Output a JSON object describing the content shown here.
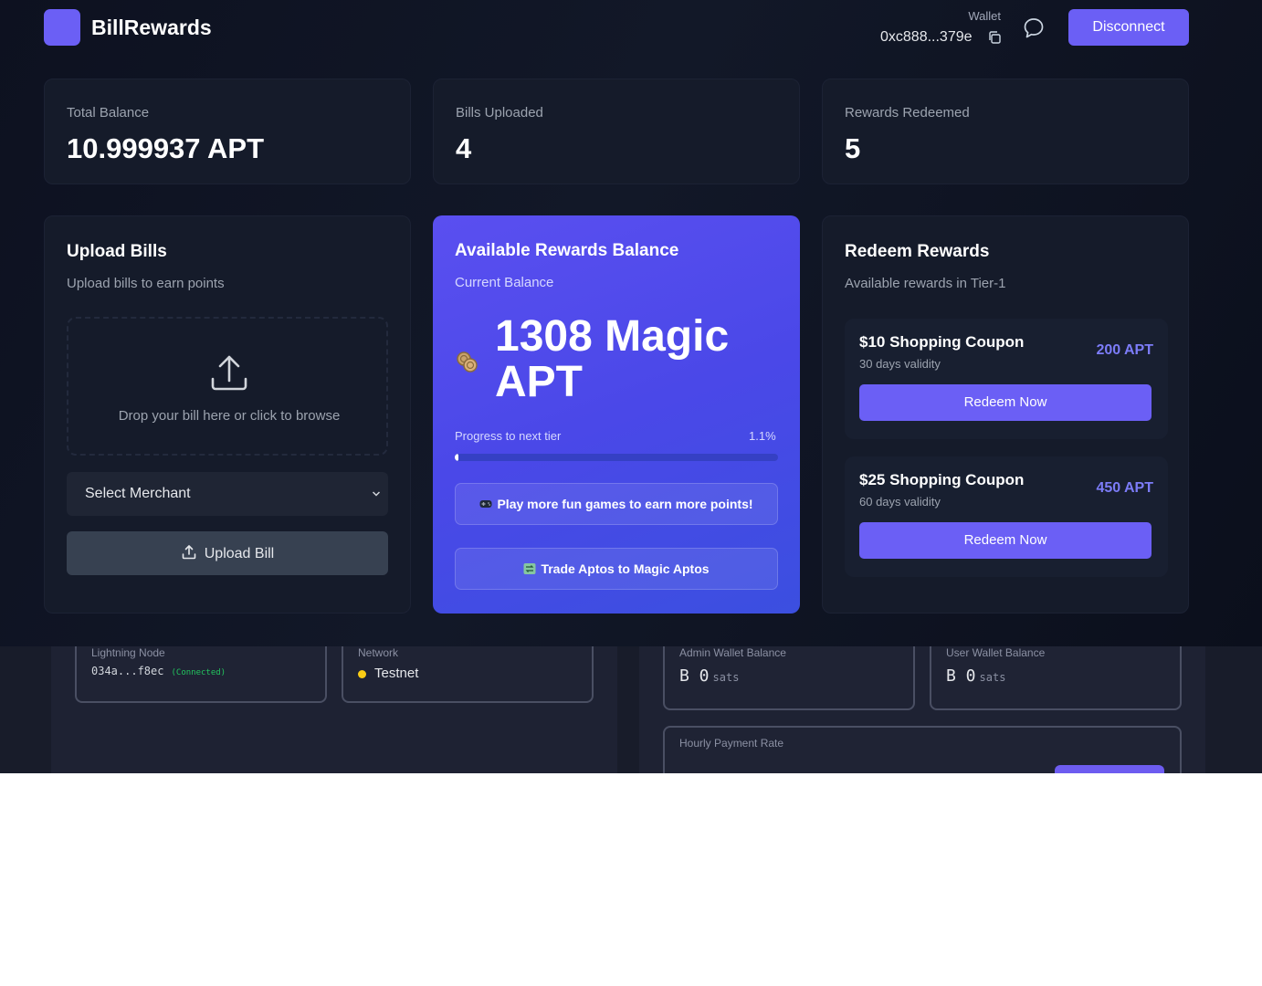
{
  "header": {
    "app_name": "BillRewards",
    "wallet_label": "Wallet",
    "wallet_address": "0xc888...379e",
    "disconnect_label": "Disconnect"
  },
  "stats": [
    {
      "label": "Total Balance",
      "value": "10.999937 APT"
    },
    {
      "label": "Bills Uploaded",
      "value": "4"
    },
    {
      "label": "Rewards Redeemed",
      "value": "5"
    }
  ],
  "upload": {
    "title": "Upload Bills",
    "subtitle": "Upload bills to earn points",
    "drop_text": "Drop your bill here or click to browse",
    "merchant_placeholder": "Select Merchant",
    "upload_button": "Upload Bill"
  },
  "rewards": {
    "title": "Available Rewards Balance",
    "subtitle": "Current Balance",
    "amount": "1308 Magic APT",
    "progress_label": "Progress to next tier",
    "progress_text": "1.1%",
    "progress_value": 1.1,
    "play_button": "Play more fun games to earn more points!",
    "trade_button": "Trade Aptos to Magic Aptos"
  },
  "redeem": {
    "title": "Redeem Rewards",
    "subtitle": "Available rewards in Tier-1",
    "coupons": [
      {
        "title": "$10 Shopping Coupon",
        "validity": "30 days validity",
        "price": "200 APT",
        "button": "Redeem Now"
      },
      {
        "title": "$25 Shopping Coupon",
        "validity": "60 days validity",
        "price": "450 APT",
        "button": "Redeem Now"
      }
    ]
  },
  "lower": {
    "lightning_label": "Lightning Node",
    "lightning_id": "034a...f8ec",
    "lightning_status": "(Connected)",
    "network_label": "Network",
    "network_value": "Testnet",
    "admin_label": "Admin Wallet Balance",
    "admin_value": "B 0",
    "admin_unit": "sats",
    "user_label": "User Wallet Balance",
    "user_value": "B 0",
    "user_unit": "sats",
    "hourly_label": "Hourly Payment Rate"
  },
  "colors": {
    "accent": "#6b5ff5",
    "panel": "#151b2a",
    "rewards_gradient": "#4a48e8"
  }
}
